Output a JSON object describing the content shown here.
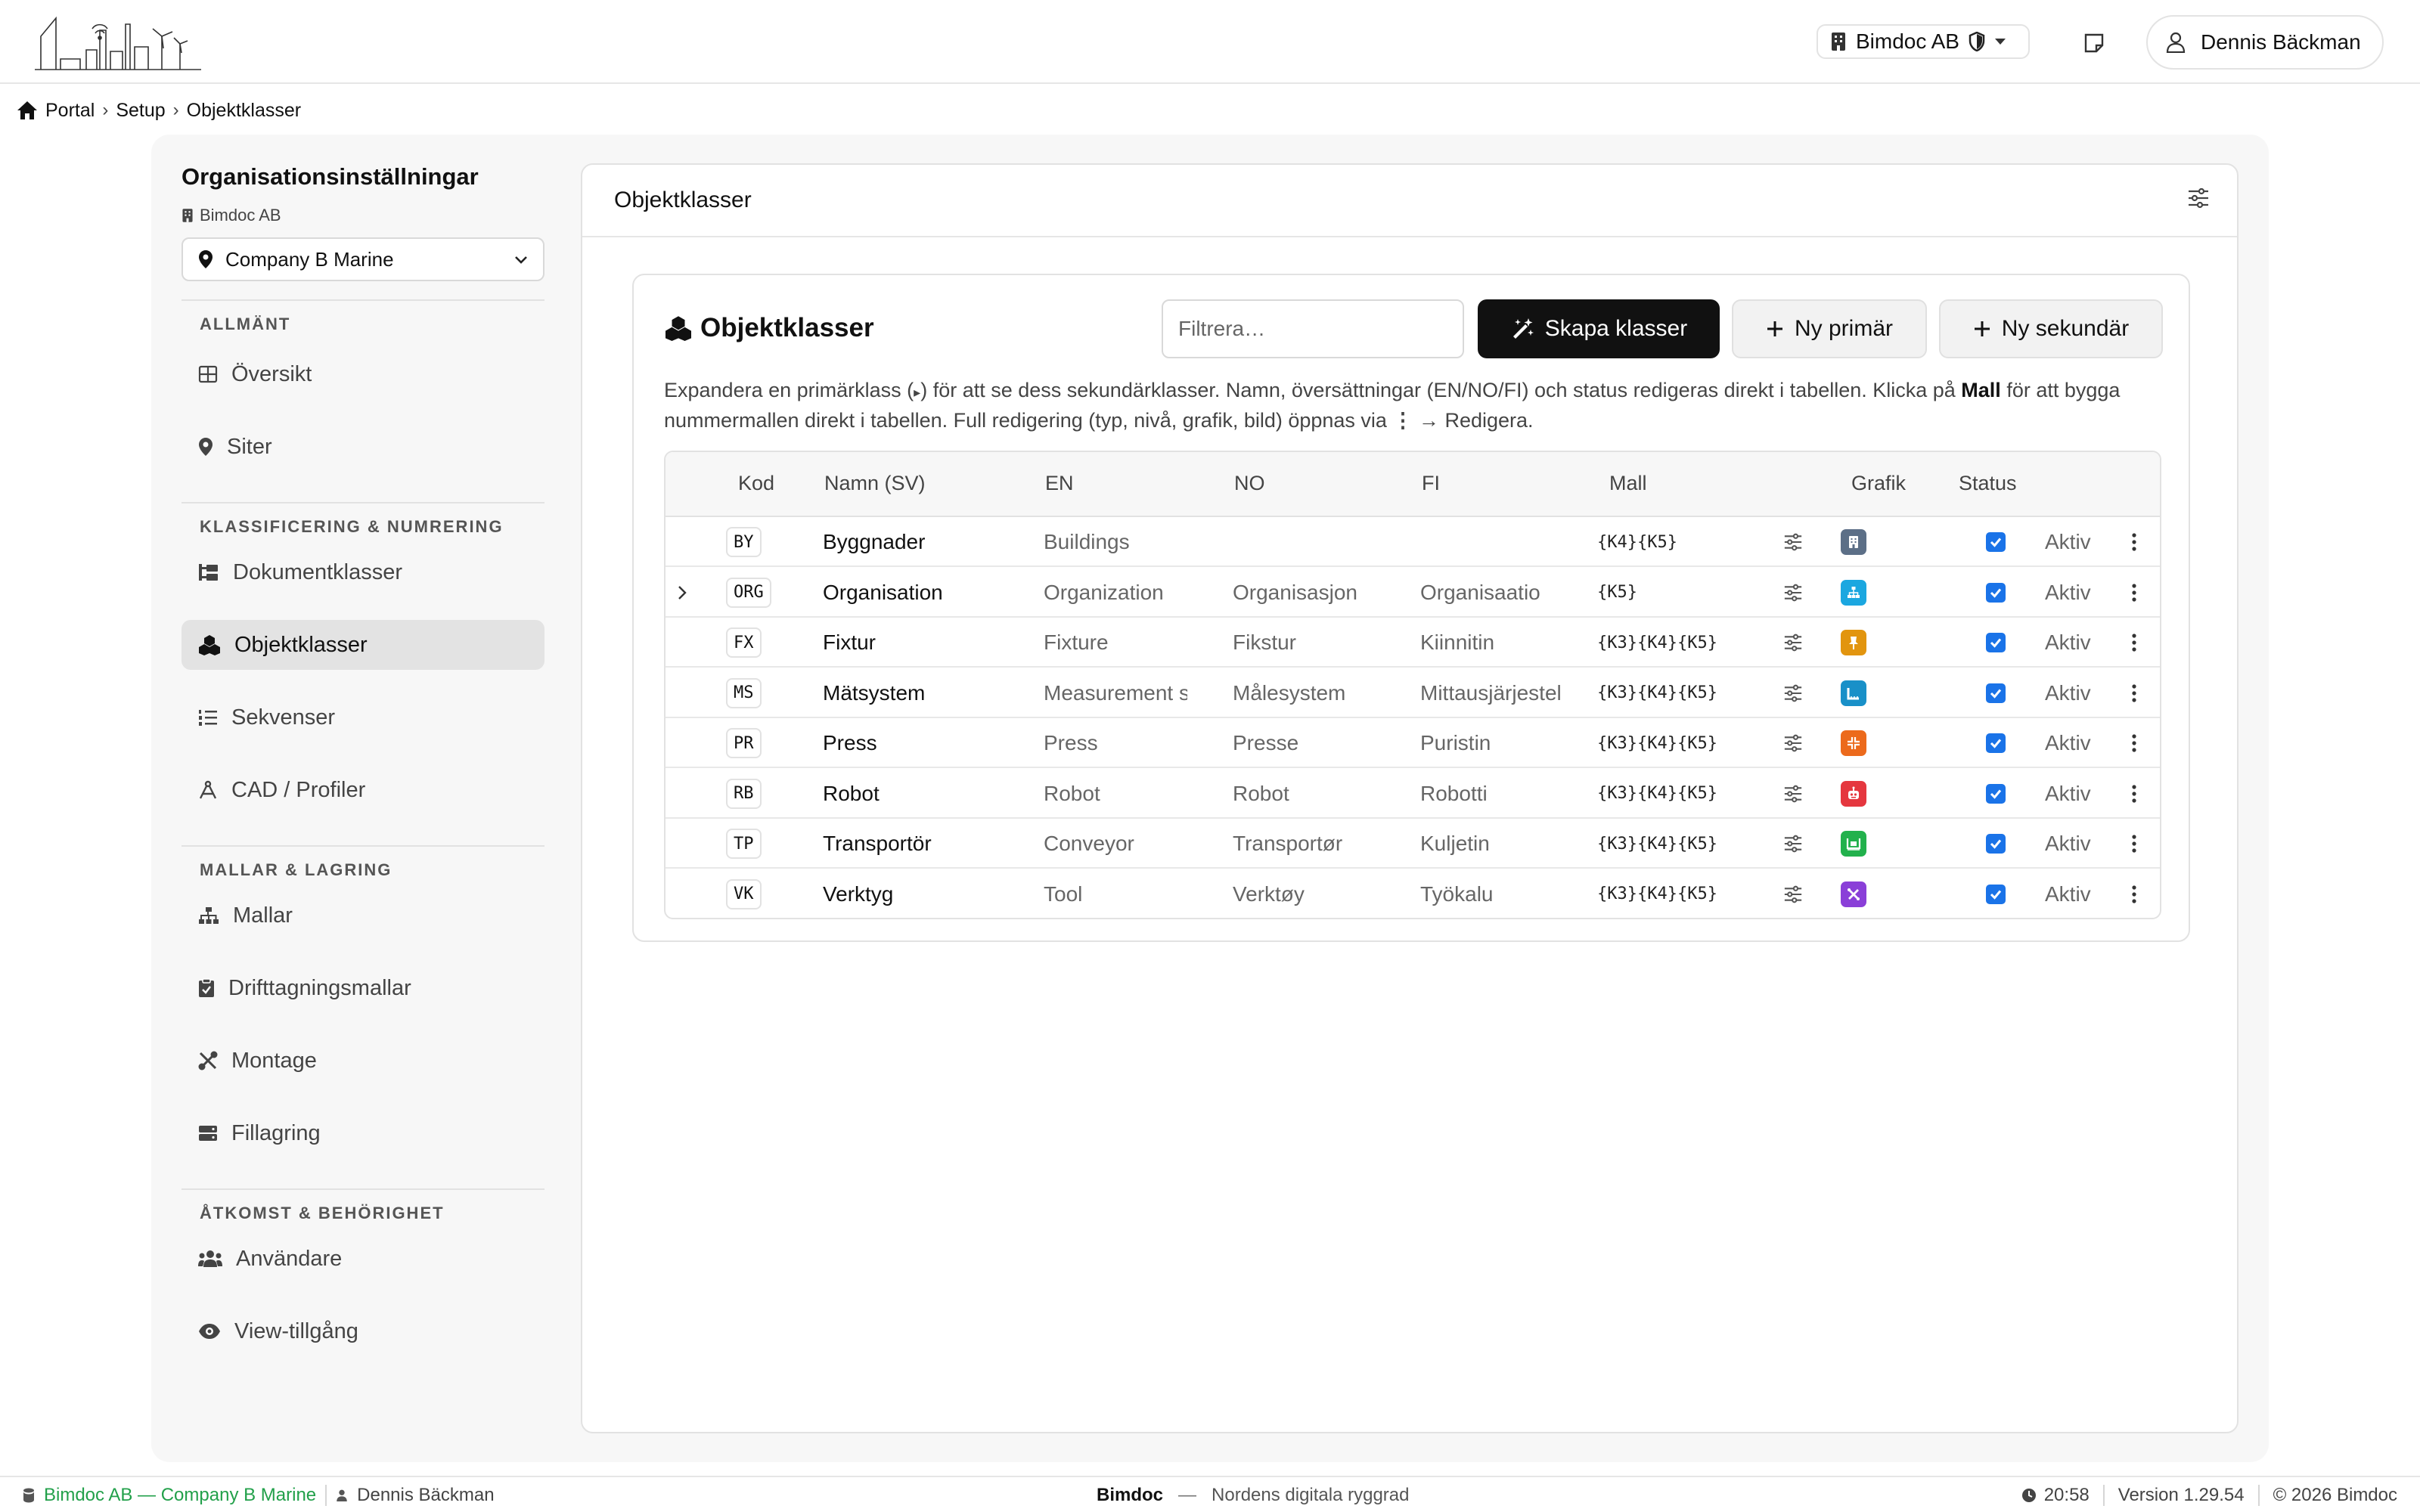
{
  "header": {
    "logo_icon": "city-skyline-logo",
    "org_name": "Bimdoc AB",
    "user_name": "Dennis Bäckman"
  },
  "breadcrumb": [
    "Portal",
    "Setup",
    "Objektklasser"
  ],
  "sidebar": {
    "title": "Organisationsinställningar",
    "org": "Bimdoc AB",
    "site": "Company B Marine",
    "groups": [
      {
        "label": "ALLMÄNT",
        "items": [
          "Översikt",
          "Siter"
        ]
      },
      {
        "label": "KLASSIFICERING & NUMRERING",
        "items": [
          "Dokumentklasser",
          "Objektklasser",
          "Sekvenser",
          "CAD / Profiler"
        ]
      },
      {
        "label": "MALLAR & LAGRING",
        "items": [
          "Mallar",
          "Drifttagningsmallar",
          "Montage",
          "Fillagring"
        ]
      },
      {
        "label": "ÅTKOMST & BEHÖRIGHET",
        "items": [
          "Användare",
          "View-tillgång"
        ]
      }
    ],
    "active": "Objektklasser"
  },
  "main": {
    "title": "Objektklasser",
    "card_title": "Objektklasser",
    "filter_placeholder": "Filtrera…",
    "buttons": {
      "create": "Skapa klasser",
      "new_primary": "Ny primär",
      "new_secondary": "Ny sekundär"
    },
    "help_part1": "Expandera en primärklass (",
    "help_part2": ") för att se dess sekundärklasser. Namn, översättningar (EN/NO/FI) och status redigeras direkt i tabellen. Klicka på ",
    "help_bold": "Mall",
    "help_part3": " för att bygga nummermallen direkt i tabellen. Full redigering (typ, nivå, grafik, bild) öppnas via ",
    "help_part4": " → Redigera.",
    "columns": {
      "kod": "Kod",
      "namn": "Namn (SV)",
      "en": "EN",
      "no": "NO",
      "fi": "FI",
      "mall": "Mall",
      "grafik": "Grafik",
      "status": "Status"
    },
    "rows": [
      {
        "code": "BY",
        "sv": "Byggnader",
        "en": "Buildings",
        "no": "",
        "fi": "",
        "mall": "{K4}{K5}",
        "icon": "building-icon",
        "color": "#5c6f87",
        "status": "Aktiv",
        "expandable": false
      },
      {
        "code": "ORG",
        "sv": "Organisation",
        "en": "Organization",
        "no": "Organisasjon",
        "fi": "Organisaatio",
        "mall": "{K5}",
        "icon": "org-chart-icon",
        "color": "#1ba7e0",
        "status": "Aktiv",
        "expandable": true
      },
      {
        "code": "FX",
        "sv": "Fixtur",
        "en": "Fixture",
        "no": "Fikstur",
        "fi": "Kiinnitin",
        "mall": "{K3}{K4}{K5}",
        "icon": "pin-icon",
        "color": "#e2950f",
        "status": "Aktiv",
        "expandable": false
      },
      {
        "code": "MS",
        "sv": "Mätsystem",
        "en": "Measurement s",
        "no": "Målesystem",
        "fi": "Mittausjärjestel",
        "mall": "{K3}{K4}{K5}",
        "icon": "ruler-icon",
        "color": "#1990c8",
        "status": "Aktiv",
        "expandable": false
      },
      {
        "code": "PR",
        "sv": "Press",
        "en": "Press",
        "no": "Presse",
        "fi": "Puristin",
        "mall": "{K3}{K4}{K5}",
        "icon": "compress-icon",
        "color": "#ec6a1c",
        "status": "Aktiv",
        "expandable": false
      },
      {
        "code": "RB",
        "sv": "Robot",
        "en": "Robot",
        "no": "Robot",
        "fi": "Robotti",
        "mall": "{K3}{K4}{K5}",
        "icon": "robot-icon",
        "color": "#e5373f",
        "status": "Aktiv",
        "expandable": false
      },
      {
        "code": "TP",
        "sv": "Transportör",
        "en": "Conveyor",
        "no": "Transportør",
        "fi": "Kuljetin",
        "mall": "{K3}{K4}{K5}",
        "icon": "conveyor-icon",
        "color": "#22b14c",
        "status": "Aktiv",
        "expandable": false
      },
      {
        "code": "VK",
        "sv": "Verktyg",
        "en": "Tool",
        "no": "Verktøy",
        "fi": "Työkalu",
        "mall": "{K3}{K4}{K5}",
        "icon": "tools-icon",
        "color": "#8a3fd8",
        "status": "Aktiv",
        "expandable": false
      }
    ]
  },
  "footer": {
    "org_site": "Bimdoc AB — Company B Marine",
    "user": "Dennis Bäckman",
    "brand": "Bimdoc",
    "dash": "—",
    "tagline": "Nordens digitala ryggrad",
    "time": "20:58",
    "version": "Version 1.29.54",
    "copyright": "© 2026 Bimdoc"
  },
  "colors": {
    "accent_dark": "#111111",
    "checkbox": "#1a73e8",
    "footer_green": "#22a04a"
  }
}
